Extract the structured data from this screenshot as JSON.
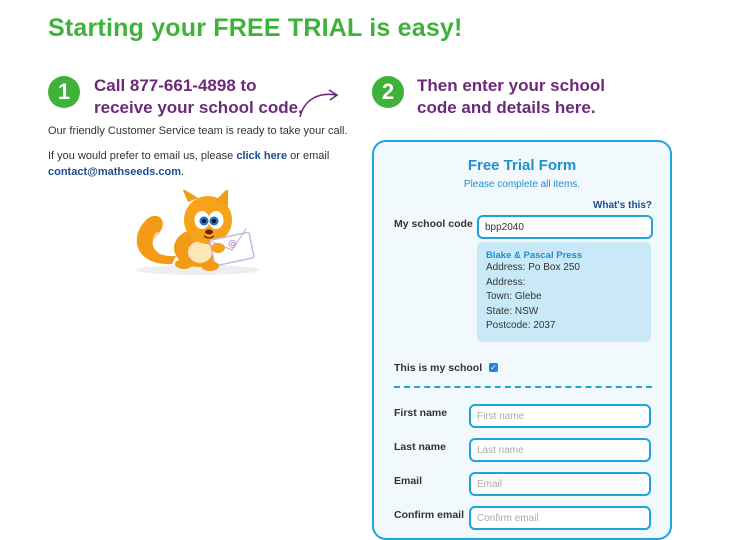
{
  "headline": "Starting your FREE TRIAL is easy!",
  "step1": {
    "number": "1",
    "title_line1": "Call 877-661-4898 to",
    "title_line2": "receive your school code.",
    "intro": "Our friendly Customer Service team is ready to take your call.",
    "email_prefix": "If you would prefer to email us, please ",
    "click_here": "click here",
    "email_middle": " or email",
    "email_address": "contact@mathseeds.com",
    "email_suffix": "."
  },
  "step2": {
    "number": "2",
    "title_line1": "Then enter your school",
    "title_line2": "code and details here."
  },
  "form": {
    "title": "Free Trial Form",
    "subtitle": "Please complete all items.",
    "whats_this": "What's this?",
    "school_code_label": "My school code",
    "school_code_value": "bpp2040",
    "school": {
      "name": "Blake & Pascal Press",
      "address1": "Address: Po Box 250",
      "address2": "Address:",
      "town": "Town: Glebe",
      "state": "State: NSW",
      "postcode": "Postcode: 2037"
    },
    "this_is_my_school_label": "This is my school",
    "this_is_my_school_checked": true,
    "fields": {
      "first_name": {
        "label": "First name",
        "placeholder": "First name"
      },
      "last_name": {
        "label": "Last name",
        "placeholder": "Last name"
      },
      "email": {
        "label": "Email",
        "placeholder": "Email"
      },
      "confirm_email": {
        "label": "Confirm email",
        "placeholder": "Confirm email"
      }
    }
  },
  "colors": {
    "green": "#3fb23a",
    "purple": "#6b2b7a",
    "blue": "#1fa3dc",
    "link": "#1f4d8c"
  }
}
